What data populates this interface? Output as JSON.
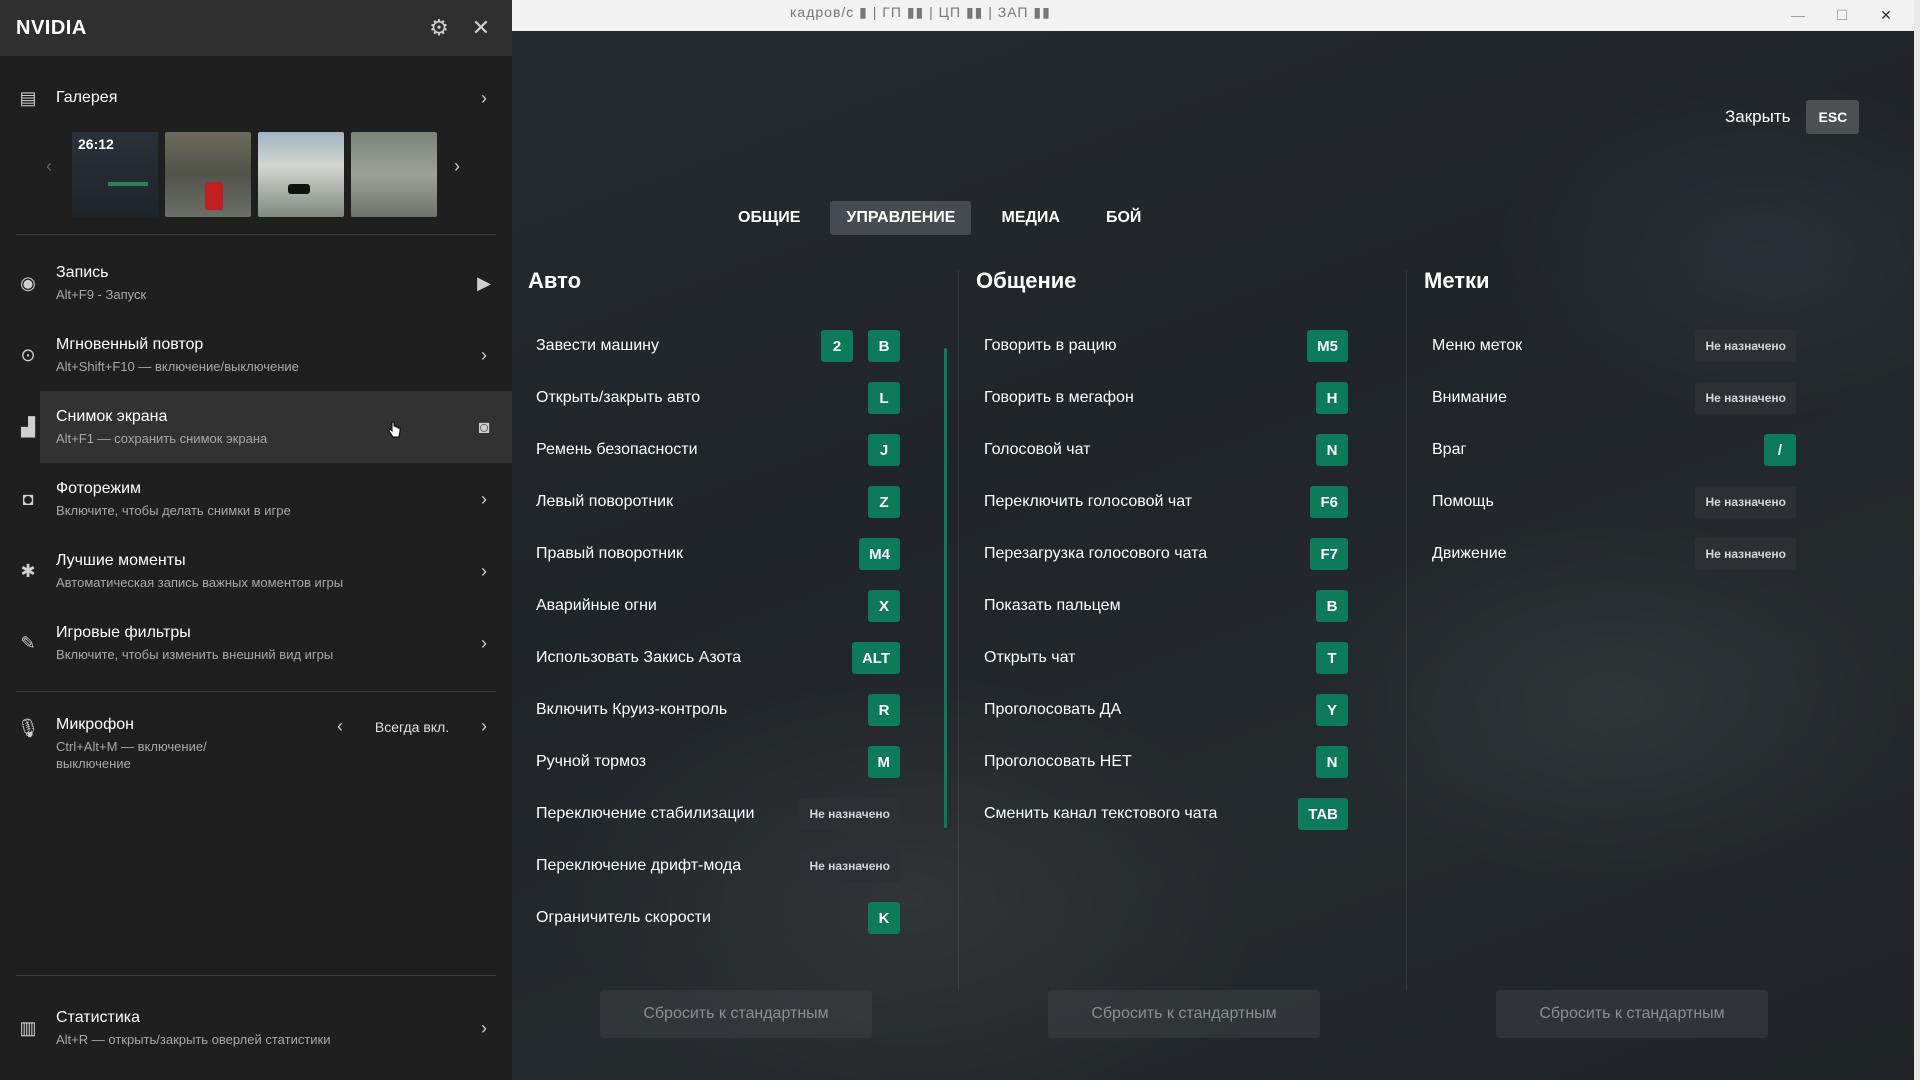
{
  "window": {
    "fps_text": "кадров/с ▮ | ГП ▮▮ | ЦП ▮▮ | ЗАП ▮▮",
    "minimize": "—",
    "maximize": "☐",
    "close": "✕"
  },
  "sidebar": {
    "title": "NVIDIA",
    "gallery": {
      "label": "Галерея",
      "thumb_time": "26:12"
    },
    "items": [
      {
        "title": "Запись",
        "sub": "Alt+F9 - Запуск"
      },
      {
        "title": "Мгновенный повтор",
        "sub": "Alt+Shift+F10 — включение/выключение"
      },
      {
        "title": "Снимок экрана",
        "sub": "Alt+F1 — сохранить снимок экрана"
      },
      {
        "title": "Фоторежим",
        "sub": "Включите, чтобы делать снимки в игре"
      },
      {
        "title": "Лучшие моменты",
        "sub": "Автоматическая запись важных моментов игры"
      },
      {
        "title": "Игровые фильтры",
        "sub": "Включите, чтобы изменить внешний вид игры"
      }
    ],
    "mic": {
      "title": "Микрофон",
      "sub": "Ctrl+Alt+M — включение/ выключение",
      "value": "Всегда вкл."
    },
    "stats": {
      "title": "Статистика",
      "sub": "Alt+R — открыть/закрыть оверлей статистики"
    }
  },
  "main": {
    "close_label": "Закрыть",
    "esc_label": "ESC",
    "tabs": [
      "ОБЩИЕ",
      "УПРАВЛЕНИЕ",
      "МЕДИА",
      "БОЙ"
    ],
    "unassigned": "Не назначено",
    "reset_label": "Сбросить к стандартным",
    "columns": [
      {
        "title": "Авто",
        "binds": [
          {
            "label": "Завести машину",
            "keys": [
              "2",
              "B"
            ]
          },
          {
            "label": "Открыть/закрыть авто",
            "keys": [
              "L"
            ]
          },
          {
            "label": "Ремень безопасности",
            "keys": [
              "J"
            ]
          },
          {
            "label": "Левый поворотник",
            "keys": [
              "Z"
            ]
          },
          {
            "label": "Правый поворотник",
            "keys": [
              "M4"
            ]
          },
          {
            "label": "Аварийные огни",
            "keys": [
              "X"
            ]
          },
          {
            "label": "Использовать Закись Азота",
            "keys": [
              "ALT"
            ]
          },
          {
            "label": "Включить Круиз-контроль",
            "keys": [
              "R"
            ]
          },
          {
            "label": "Ручной тормоз",
            "keys": [
              "M"
            ]
          },
          {
            "label": "Переключение стабилизации",
            "keys": []
          },
          {
            "label": "Переключение дрифт-мода",
            "keys": []
          },
          {
            "label": "Ограничитель скорости",
            "keys": [
              "K"
            ]
          }
        ]
      },
      {
        "title": "Общение",
        "binds": [
          {
            "label": "Говорить в рацию",
            "keys": [
              "M5"
            ]
          },
          {
            "label": "Говорить в мегафон",
            "keys": [
              "H"
            ]
          },
          {
            "label": "Голосовой чат",
            "keys": [
              "N"
            ]
          },
          {
            "label": "Переключить голосовой чат",
            "keys": [
              "F6"
            ]
          },
          {
            "label": "Перезагрузка голосового чата",
            "keys": [
              "F7"
            ]
          },
          {
            "label": "Показать пальцем",
            "keys": [
              "B"
            ]
          },
          {
            "label": "Открыть чат",
            "keys": [
              "T"
            ]
          },
          {
            "label": "Проголосовать ДА",
            "keys": [
              "Y"
            ]
          },
          {
            "label": "Проголосовать НЕТ",
            "keys": [
              "N"
            ]
          },
          {
            "label": "Сменить канал текстового чата",
            "keys": [
              "TAB"
            ]
          }
        ]
      },
      {
        "title": "Метки",
        "binds": [
          {
            "label": "Меню меток",
            "keys": []
          },
          {
            "label": "Внимание",
            "keys": []
          },
          {
            "label": "Враг",
            "keys": [
              "/"
            ]
          },
          {
            "label": "Помощь",
            "keys": []
          },
          {
            "label": "Движение",
            "keys": []
          }
        ]
      }
    ]
  },
  "colors": {
    "accent_green": "#0d7a5b",
    "sidebar_bg": "#1f1f1f",
    "header_bg": "#2f2f2f"
  }
}
